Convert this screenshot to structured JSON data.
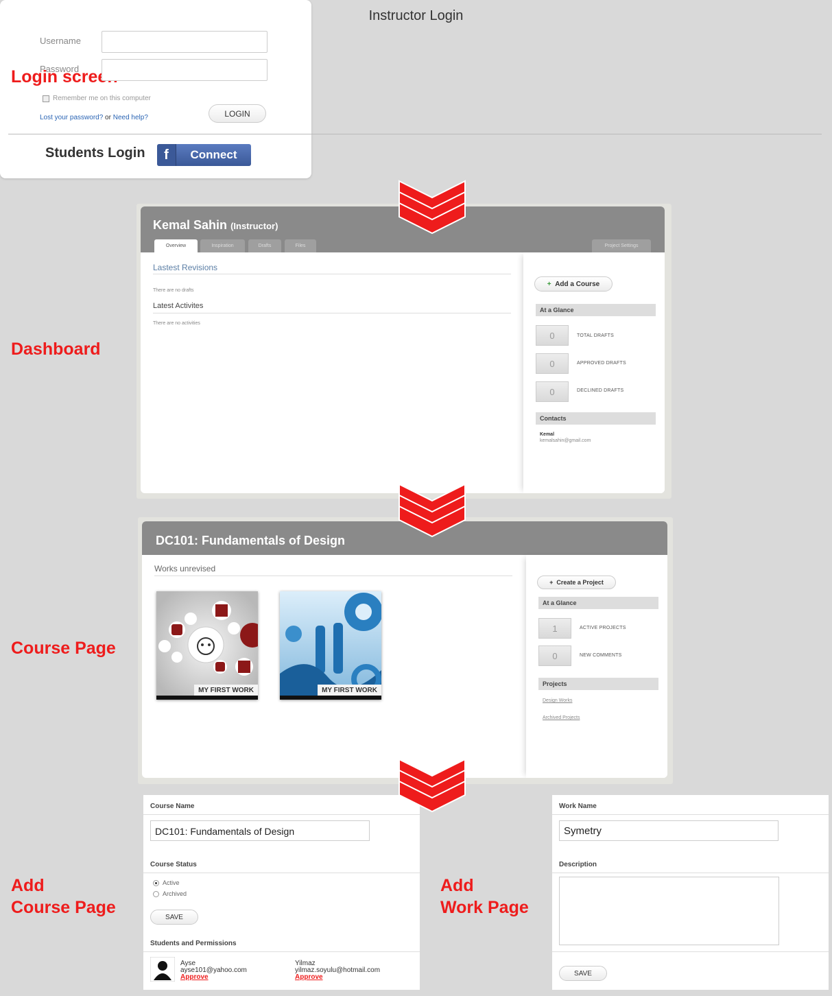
{
  "section_labels": {
    "login": "Login screen",
    "dashboard": "Dashboard",
    "course": "Course Page",
    "add_course": [
      "Add",
      "Course Page"
    ],
    "add_work": [
      "Add",
      "Work Page"
    ]
  },
  "login": {
    "title": "Instructor Login",
    "username_label": "Username",
    "password_label": "Password",
    "remember": "Remember me on this computer",
    "lost_password": "Lost your password?",
    "or": " or ",
    "need_help": "Need help?",
    "login_button": "LOGIN",
    "students_login": "Students Login",
    "fb_letter": "f",
    "fb_connect": "Connect"
  },
  "dashboard": {
    "name": "Kemal Sahin",
    "role": "(Instructor)",
    "tabs": [
      "Overview",
      "Inspiration",
      "Drafts",
      "Files"
    ],
    "settings_tab": "Project Settings",
    "revisions_title": "Lastest Revisions",
    "no_drafts": "There are no drafts",
    "activities_title": "Latest Activites",
    "no_activities": "There are no activities",
    "add_course": "Add a Course",
    "glance": "At a Glance",
    "stats": [
      {
        "value": "0",
        "label": "TOTAL DRAFTS"
      },
      {
        "value": "0",
        "label": "APPROVED DRAFTS"
      },
      {
        "value": "0",
        "label": "DECLINED DRAFTS"
      }
    ],
    "contacts": "Contacts",
    "contact_name": "Kemal",
    "contact_email": "kemalsahin@gmail.com"
  },
  "course": {
    "title": "DC101: Fundamentals of Design",
    "works_title": "Works unrevised",
    "works": [
      "MY FIRST WORK",
      "MY FIRST WORK"
    ],
    "create_project": "Create a Project",
    "glance": "At a Glance",
    "stats": [
      {
        "value": "1",
        "label": "ACTIVE PROJECTS"
      },
      {
        "value": "0",
        "label": "NEW COMMENTS"
      }
    ],
    "projects": "Projects",
    "project_links": [
      "Design Works",
      "Archived Projects"
    ]
  },
  "add_course": {
    "name_label": "Course Name",
    "name_value": "DC101: Fundamentals of Design",
    "status_label": "Course Status",
    "status_options": [
      "Active",
      "Archived"
    ],
    "save": "SAVE",
    "students_label": "Students and Permissions",
    "students": [
      {
        "name": "Ayse",
        "email": "ayse101@yahoo.com",
        "action": "Approve"
      },
      {
        "name": "Yilmaz",
        "email": "yilmaz.soyulu@hotmail.com",
        "action": "Approve"
      }
    ]
  },
  "add_work": {
    "name_label": "Work Name",
    "name_value": "Symetry",
    "description_label": "Description",
    "save": "SAVE"
  },
  "colors": {
    "accent_red": "#ee1c1c",
    "header_gray": "#8a8a8a",
    "facebook_blue": "#3b5998"
  }
}
